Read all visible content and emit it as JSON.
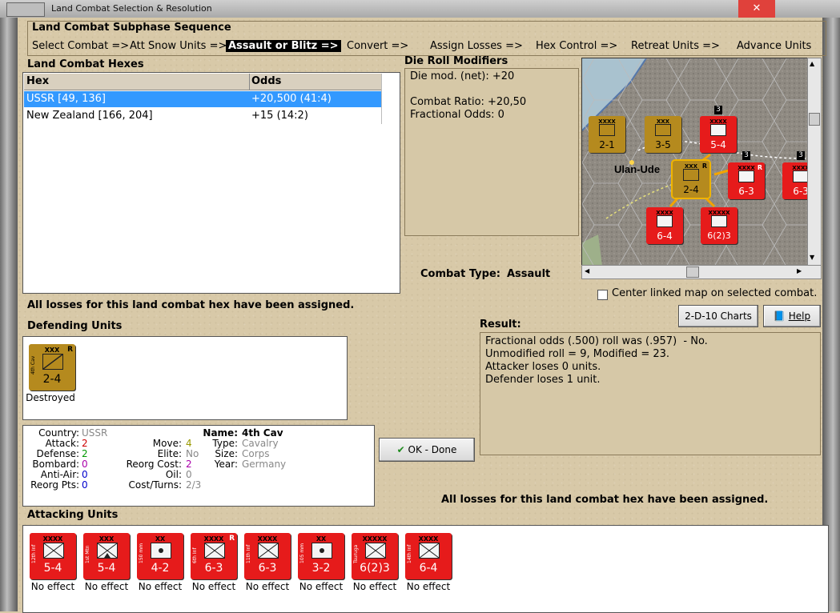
{
  "window": {
    "title": "Land Combat Selection & Resolution"
  },
  "subphase": {
    "title": "Land Combat Subphase Sequence",
    "steps": [
      "Select Combat =>",
      "Att Snow Units =>",
      "Assault or Blitz =>",
      "Convert =>",
      "Assign Losses =>",
      "Hex Control =>",
      "Retreat Units =>",
      "Advance Units"
    ],
    "active_index": 2
  },
  "hexes": {
    "title": "Land Combat Hexes",
    "columns": [
      "Hex",
      "Odds"
    ],
    "rows": [
      {
        "hex": "USSR [49, 136]",
        "odds": "+20,500 (41:4)",
        "selected": true
      },
      {
        "hex": "New Zealand [166, 204]",
        "odds": "+15 (14:2)",
        "selected": false
      }
    ]
  },
  "drm": {
    "title": "Die Roll Modifiers",
    "lines": [
      "Die mod. (net): +20",
      "",
      "Combat Ratio: +20,50",
      "Fractional Odds: 0"
    ]
  },
  "combat_type": {
    "label": "Combat Type:",
    "value": "Assault"
  },
  "losses_msg_1": "All losses for this land combat hex have been assigned.",
  "losses_msg_2": "All losses for this land combat hex have been assigned.",
  "map": {
    "city": "Ulan-Ude",
    "center_label": "Center linked map on selected combat.",
    "counters": [
      {
        "size": "XXXX",
        "str": "2-1",
        "color": "gold",
        "name": "10th Guard"
      },
      {
        "size": "XXX",
        "str": "3-5",
        "color": "gold",
        "name": "3rd Guard"
      },
      {
        "size": "XXXX",
        "str": "5-4",
        "color": "red",
        "name": "14th Inf",
        "stack": "3"
      },
      {
        "size": "XXX",
        "str": "2-4",
        "color": "gold",
        "name": "4th Cav",
        "flag": "R"
      },
      {
        "size": "XXXX",
        "str": "6-3",
        "color": "red",
        "name": "6th Inf",
        "flag": "R",
        "stack": "3"
      },
      {
        "size": "XXXX",
        "str": "6-3",
        "color": "red",
        "name": "11th Inf",
        "stack": "3"
      },
      {
        "size": "XXXX",
        "str": "6-4",
        "color": "red",
        "name": "14th Inf"
      },
      {
        "size": "XXXXX",
        "str": "6(2)3",
        "color": "red",
        "name": "Tsuruga"
      }
    ]
  },
  "buttons": {
    "charts": "2-D-10 Charts",
    "help": "Help",
    "ok": "OK - Done"
  },
  "defending": {
    "title": "Defending Units",
    "units": [
      {
        "size": "XXX",
        "str": "2-4",
        "name": "4th Cav",
        "flag": "R",
        "status": "Destroyed"
      }
    ]
  },
  "unit_info": {
    "country_label": "Country:",
    "country": "USSR",
    "attack_label": "Attack:",
    "attack": "2",
    "defense_label": "Defense:",
    "defense": "2",
    "bombard_label": "Bombard:",
    "bombard": "0",
    "antiair_label": "Anti-Air:",
    "antiair": "0",
    "reorgpts_label": "Reorg Pts:",
    "reorgpts": "0",
    "move_label": "Move:",
    "move": "4",
    "elite_label": "Elite:",
    "elite": "No",
    "reorgcost_label": "Reorg Cost:",
    "reorgcost": "2",
    "oil_label": "Oil:",
    "oil": "0",
    "costturns_label": "Cost/Turns:",
    "costturns": "2/3",
    "name_label": "Name:",
    "name": "4th Cav",
    "type_label": "Type:",
    "type": "Cavalry",
    "size_label": "Size:",
    "size": "Corps",
    "year_label": "Year:",
    "year": "Germany"
  },
  "result": {
    "title": "Result:",
    "lines": [
      "Fractional odds (.500) roll was (.957)  - No.",
      "Unmodified roll = 9, Modified = 23.",
      "Attacker loses 0 units.",
      "Defender loses 1 unit."
    ]
  },
  "attacking": {
    "title": "Attacking Units",
    "units": [
      {
        "size": "XXXX",
        "str": "5-4",
        "name": "12th Inf",
        "status": "No effect",
        "sym": "inf"
      },
      {
        "size": "XXX",
        "str": "5-4",
        "name": "1st Mtn",
        "status": "No effect",
        "sym": "inf"
      },
      {
        "size": "XX",
        "str": "4-2",
        "name": "150 mm",
        "status": "No effect",
        "sym": "art"
      },
      {
        "size": "XXXX",
        "str": "6-3",
        "name": "6th Inf",
        "flag": "R",
        "status": "No effect",
        "sym": "inf"
      },
      {
        "size": "XXXX",
        "str": "6-3",
        "name": "11th Inf",
        "status": "No effect",
        "sym": "inf"
      },
      {
        "size": "XX",
        "str": "3-2",
        "name": "105 mm",
        "status": "No effect",
        "sym": "art"
      },
      {
        "size": "XXXXX",
        "str": "6(2)3",
        "name": "Tsuruga",
        "status": "No effect",
        "sym": "inf"
      },
      {
        "size": "XXXX",
        "str": "6-4",
        "name": "14th Inf",
        "status": "No effect",
        "sym": "inf"
      }
    ]
  },
  "colors": {
    "selection": "#3399ff",
    "unit_red": "#e61b1b",
    "unit_gold": "#b58a1e",
    "attack": "#cc0000",
    "defense": "#009900",
    "bombard": "#aa00aa",
    "antiair": "#0000cc",
    "move": "#999900"
  }
}
